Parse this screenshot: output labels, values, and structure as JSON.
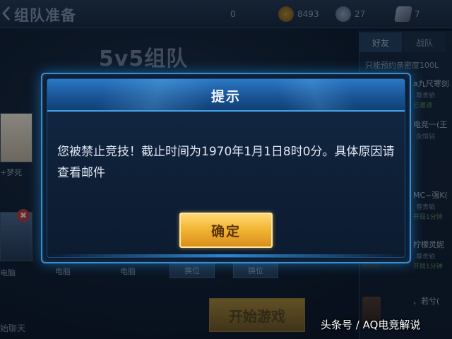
{
  "header": {
    "title": "组队准备",
    "currencies": [
      {
        "icon": "rank-icon",
        "value": "0"
      },
      {
        "icon": "gold-coin-icon",
        "value": "8493"
      },
      {
        "icon": "diamond-icon",
        "value": "27"
      },
      {
        "icon": "voucher-icon",
        "value": "7"
      }
    ]
  },
  "lobby": {
    "mode_title": "5v5组队",
    "slot_labels": [
      "+梦死",
      "电脑",
      "电脑",
      "电脑"
    ],
    "swap_buttons": [
      "换位",
      "换位"
    ],
    "start_button": "开始游戏",
    "chat_hint": "始聊天"
  },
  "side_panel": {
    "tabs": [
      "好友",
      "战队"
    ],
    "hint": "只能预约亲密度100L",
    "friends": [
      {
        "name": "a九尺寒剑",
        "sub": "尊贵铂",
        "state": "已邀请"
      },
      {
        "name": "电竞一(王",
        "sub": "永恒钻",
        "state": ""
      },
      {
        "name": "MC~强K(",
        "sub": "尊贵铂",
        "state": "开局1分钟"
      },
      {
        "name": "柠檬灵妮",
        "sub": "尊贵铂",
        "state": "开局1分钟"
      },
      {
        "name": "、若兮(",
        "sub": "",
        "state": ""
      }
    ]
  },
  "dialog": {
    "title": "提示",
    "message": "您被禁止竞技！截止时间为1970年1月1日8时0分。具体原因请查看邮件",
    "confirm_button": "确定"
  },
  "watermark": "头条号 / AQ电竞解说",
  "colors": {
    "dialog_border": "#3a8ed0",
    "dialog_header": "#1a5597",
    "confirm_button": "#f3b735"
  }
}
